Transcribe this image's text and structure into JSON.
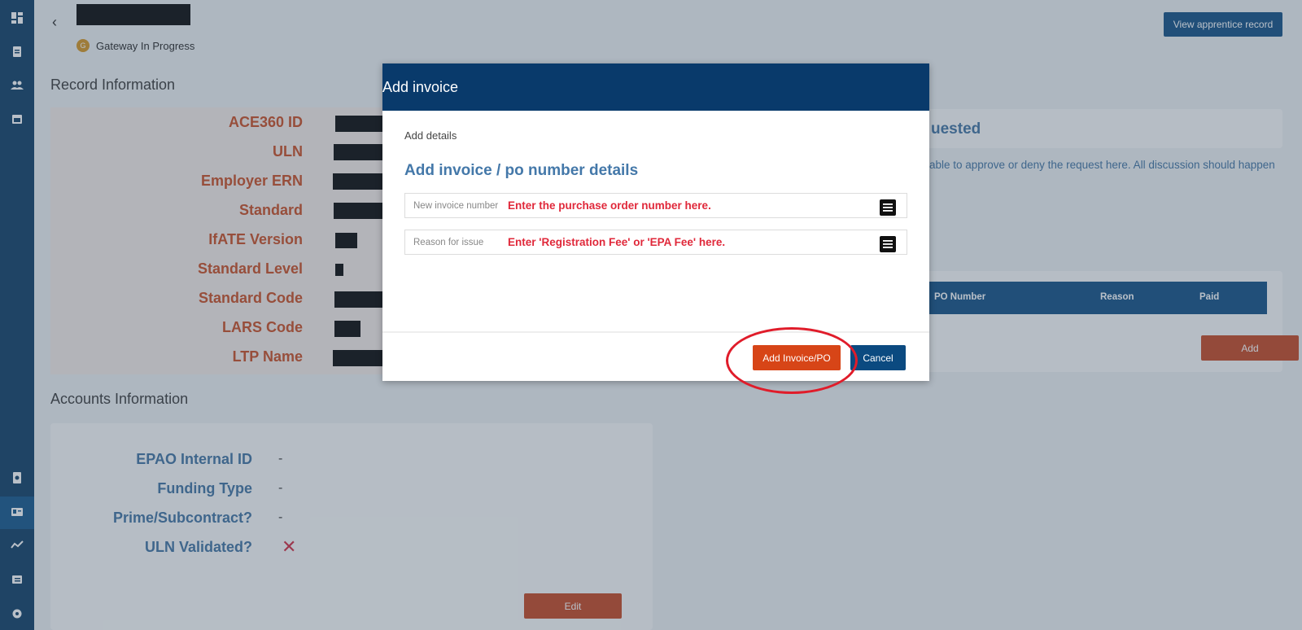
{
  "header": {
    "status_badge": "G",
    "status_text": "Gateway In Progress",
    "view_record_label": "View apprentice record"
  },
  "record": {
    "title": "Record Information",
    "labels": [
      "ACE360 ID",
      "ULN",
      "Employer ERN",
      "Standard",
      "IfATE Version",
      "Standard Level",
      "Standard Code",
      "LARS Code",
      "LTP Name"
    ]
  },
  "accounts": {
    "title": "Accounts Information",
    "labels": [
      "EPAO Internal ID",
      "Funding Type",
      "Prime/Subcontract?",
      "ULN Validated?"
    ],
    "values": [
      "-",
      "-",
      "-"
    ],
    "validated_mark": "✕",
    "edit_label": "Edit"
  },
  "right_panel": {
    "card_title_partial": "uested",
    "body_text_partial": "able to approve or deny the request here. All discussion should happen"
  },
  "invoices_table": {
    "columns": [
      "PO Number",
      "Reason",
      "Paid"
    ],
    "add_label": "Add"
  },
  "modal": {
    "title": "Add invoice",
    "subtitle": "Add details",
    "heading": "Add invoice / po number details",
    "fields": [
      {
        "label": "New invoice number",
        "value": "Enter the purchase order number here."
      },
      {
        "label": "Reason for issue",
        "value": "Enter 'Registration Fee' or 'EPA Fee' here."
      }
    ],
    "submit_label": "Add Invoice/PO",
    "cancel_label": "Cancel"
  },
  "colors": {
    "sidebar": "#08385f",
    "primary": "#0b4a80",
    "accent": "#c4421b",
    "annotation": "#e01c2a"
  }
}
